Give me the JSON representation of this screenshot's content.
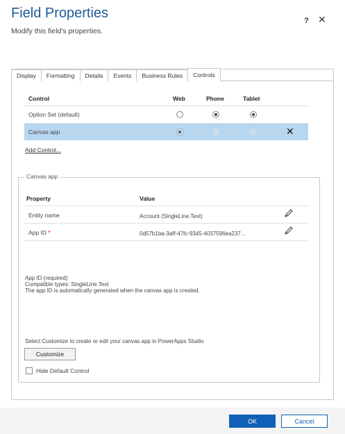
{
  "header": {
    "title": "Field Properties",
    "subtitle": "Modify this field's properties.",
    "help_label": "?",
    "close_label": "✕"
  },
  "tabs": [
    "Display",
    "Formatting",
    "Details",
    "Events",
    "Business Rules",
    "Controls"
  ],
  "active_tab": "Controls",
  "controls_table": {
    "headers": {
      "control": "Control",
      "web": "Web",
      "phone": "Phone",
      "tablet": "Tablet"
    },
    "rows": [
      {
        "label": "Option Set (default)",
        "web": "unchecked",
        "phone": "checked",
        "tablet": "checked",
        "selected": false
      },
      {
        "label": "Canvas app",
        "web": "checked",
        "phone": "disabled",
        "tablet": "disabled",
        "selected": true,
        "remove_icon": "close-icon"
      }
    ],
    "add_control_label": "Add Control..."
  },
  "canvas_app": {
    "legend": "Canvas app",
    "headers": {
      "property": "Property",
      "value": "Value"
    },
    "properties": [
      {
        "name": "Entity name",
        "required": false,
        "value": "Account (SingleLine.Text)",
        "icon": "pencil-icon"
      },
      {
        "name": "App ID",
        "required": true,
        "required_mark": "*",
        "value": "0d57b1ba-3aff-47fc-9345-4037596ea237...",
        "icon": "pencil-icon"
      }
    ],
    "info_lines": [
      "App ID (required)",
      "Compatible types: SingleLine.Text",
      "The app ID is automatically generated when the canvas app is created."
    ],
    "customize_hint": "Select Customize to create or edit your canvas app in PowerApps Studio",
    "customize_label": "Customize",
    "hide_default_label": "Hide Default Control",
    "hide_default_checked": false
  },
  "footer": {
    "ok_label": "OK",
    "cancel_label": "Cancel"
  },
  "colors": {
    "title": "#1e5a9a",
    "selected_row": "#b8d6ee",
    "primary_button": "#1160b7"
  }
}
